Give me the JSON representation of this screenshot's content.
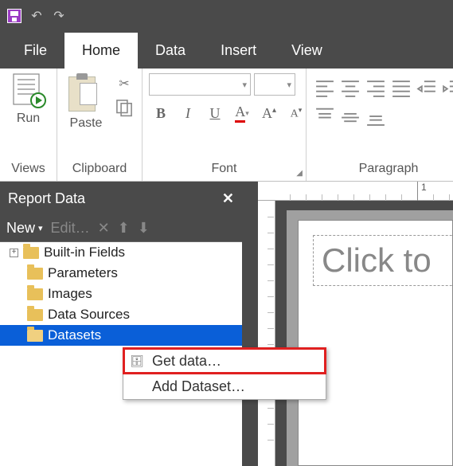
{
  "qat": {
    "save": "save-icon",
    "undo": "↶",
    "redo": "↷"
  },
  "tabs": {
    "file": "File",
    "home": "Home",
    "data": "Data",
    "insert": "Insert",
    "view": "View",
    "active": "home"
  },
  "ribbon": {
    "views": {
      "label": "Views",
      "run": "Run"
    },
    "clipboard": {
      "label": "Clipboard",
      "paste": "Paste"
    },
    "font": {
      "label": "Font",
      "bold": "B",
      "italic": "I",
      "underline": "U"
    },
    "paragraph": {
      "label": "Paragraph"
    }
  },
  "panel": {
    "title": "Report Data",
    "close": "✕",
    "toolbar": {
      "new": "New",
      "edit": "Edit…",
      "delete": "✕",
      "up": "⬆",
      "down": "⬇"
    },
    "tree": [
      {
        "label": "Built-in Fields",
        "expandable": true
      },
      {
        "label": "Parameters"
      },
      {
        "label": "Data Sources"
      },
      {
        "label": "Images"
      },
      {
        "label": "Datasets",
        "selected": true
      }
    ]
  },
  "context_menu": {
    "items": [
      {
        "label": "Get data…",
        "icon": "db",
        "highlight": true
      },
      {
        "label": "Add Dataset…",
        "icon": ""
      }
    ]
  },
  "canvas": {
    "ruler_mark": "1",
    "placeholder": "Click to"
  }
}
